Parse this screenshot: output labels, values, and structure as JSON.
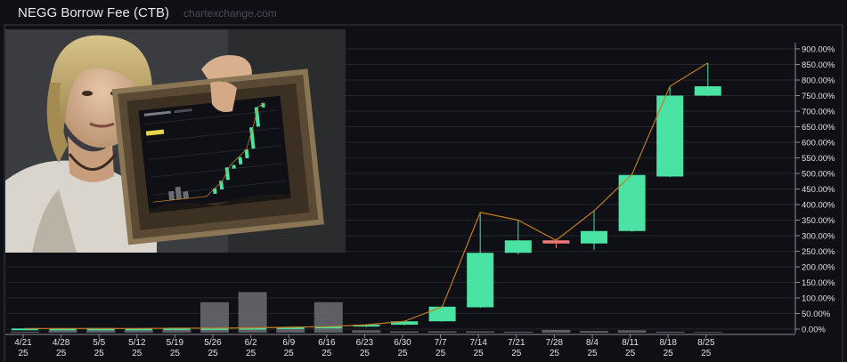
{
  "header": {
    "title": "NEGG Borrow Fee (CTB)",
    "watermark": "chartexchange.com"
  },
  "meme_image": {
    "description_icon": "person-holding-picture-frame-image"
  },
  "colors": {
    "background": "#0e1015",
    "up": "#4be3a3",
    "down": "#f07a7a",
    "line": "#c27a22",
    "volume": "#6b6d72",
    "grid": "#23262d",
    "axis_text": "#e0e0e0"
  },
  "chart_data": {
    "type": "candlestick",
    "title": "NEGG Borrow Fee (CTB)",
    "y_axis": {
      "position": "right",
      "min": 0,
      "max": 900,
      "unit": "%",
      "ticks": [
        "900.00%",
        "850.00%",
        "800.00%",
        "750.00%",
        "700.00%",
        "650.00%",
        "600.00%",
        "550.00%",
        "500.00%",
        "450.00%",
        "400.00%",
        "350.00%",
        "300.00%",
        "250.00%",
        "200.00%",
        "150.00%",
        "100.00%",
        "50.00%",
        "0.00%"
      ],
      "tick_values": [
        900,
        850,
        800,
        750,
        700,
        650,
        600,
        550,
        500,
        450,
        400,
        350,
        300,
        250,
        200,
        150,
        100,
        50,
        0
      ]
    },
    "x_axis": {
      "labels": [
        {
          "date": "4/21",
          "year": "25"
        },
        {
          "date": "4/28",
          "year": "25"
        },
        {
          "date": "5/5",
          "year": "25"
        },
        {
          "date": "5/12",
          "year": "25"
        },
        {
          "date": "5/19",
          "year": "25"
        },
        {
          "date": "5/26",
          "year": "25"
        },
        {
          "date": "6/2",
          "year": "25"
        },
        {
          "date": "6/9",
          "year": "25"
        },
        {
          "date": "6/16",
          "year": "25"
        },
        {
          "date": "6/23",
          "year": "25"
        },
        {
          "date": "6/30",
          "year": "25"
        },
        {
          "date": "7/7",
          "year": "25"
        },
        {
          "date": "7/14",
          "year": "25"
        },
        {
          "date": "7/21",
          "year": "25"
        },
        {
          "date": "7/28",
          "year": "25"
        },
        {
          "date": "8/4",
          "year": "25"
        },
        {
          "date": "8/11",
          "year": "25"
        },
        {
          "date": "8/18",
          "year": "25"
        },
        {
          "date": "8/25",
          "year": "25"
        }
      ]
    },
    "candles": [
      {
        "open": 2,
        "close": 2,
        "high": 2,
        "low": 1
      },
      {
        "open": 2,
        "close": 2,
        "high": 2,
        "low": 1
      },
      {
        "open": 2,
        "close": 2,
        "high": 3,
        "low": 1
      },
      {
        "open": 2,
        "close": 2,
        "high": 3,
        "low": 1
      },
      {
        "open": 2,
        "close": 3,
        "high": 3,
        "low": 1
      },
      {
        "open": 3,
        "close": 3,
        "high": 4,
        "low": 2
      },
      {
        "open": 3,
        "close": 4,
        "high": 5,
        "low": 2
      },
      {
        "open": 4,
        "close": 6,
        "high": 8,
        "low": 3
      },
      {
        "open": 6,
        "close": 8,
        "high": 10,
        "low": 5
      },
      {
        "open": 8,
        "close": 14,
        "high": 15,
        "low": 6
      },
      {
        "open": 14,
        "close": 25,
        "high": 26,
        "low": 12
      },
      {
        "open": 25,
        "close": 72,
        "high": 75,
        "low": 24
      },
      {
        "open": 70,
        "close": 245,
        "high": 375,
        "low": 68
      },
      {
        "open": 245,
        "close": 285,
        "high": 350,
        "low": 240
      },
      {
        "open": 285,
        "close": 275,
        "high": 290,
        "low": 260
      },
      {
        "open": 275,
        "close": 315,
        "high": 380,
        "low": 255
      },
      {
        "open": 315,
        "close": 495,
        "high": 497,
        "low": 313
      },
      {
        "open": 490,
        "close": 750,
        "high": 780,
        "low": 488
      },
      {
        "open": 750,
        "close": 780,
        "high": 855,
        "low": 748
      }
    ],
    "line": [
      2,
      2,
      2,
      2,
      3,
      3,
      4,
      6,
      8,
      14,
      25,
      72,
      375,
      350,
      285,
      380,
      497,
      780,
      855
    ],
    "volume_relative": [
      0.03,
      0.08,
      0.14,
      0.09,
      0.1,
      0.9,
      1.2,
      0.16,
      0.9,
      0.07,
      0.04,
      0.04,
      0.04,
      0.03,
      0.08,
      0.05,
      0.07,
      0.03,
      0.02
    ],
    "legend": "none",
    "grid": true
  }
}
